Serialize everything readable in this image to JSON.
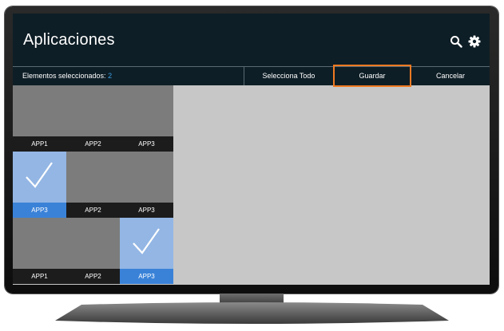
{
  "header": {
    "title": "Aplicaciones",
    "search_icon": "search-icon",
    "settings_icon": "gear-icon"
  },
  "toolbar": {
    "selected_label": "Elementos seleccionados:",
    "selected_count": "2",
    "select_all": "Selecciona Todo",
    "save": "Guardar",
    "cancel": "Cancelar"
  },
  "colors": {
    "header_bg": "#0e1e26",
    "accent_count": "#3aa0e6",
    "focus_border": "#f07a22",
    "selected_tile": "#93b6e4",
    "selected_label": "#3a82d8"
  },
  "apps": [
    [
      {
        "label": "APP1",
        "selected": false
      },
      {
        "label": "APP2",
        "selected": false
      },
      {
        "label": "APP3",
        "selected": false
      }
    ],
    [
      {
        "label": "APP3",
        "selected": true
      },
      {
        "label": "APP2",
        "selected": false
      },
      {
        "label": "APP3",
        "selected": false
      }
    ],
    [
      {
        "label": "APP1",
        "selected": false
      },
      {
        "label": "APP2",
        "selected": false
      },
      {
        "label": "APP3",
        "selected": true
      }
    ]
  ]
}
